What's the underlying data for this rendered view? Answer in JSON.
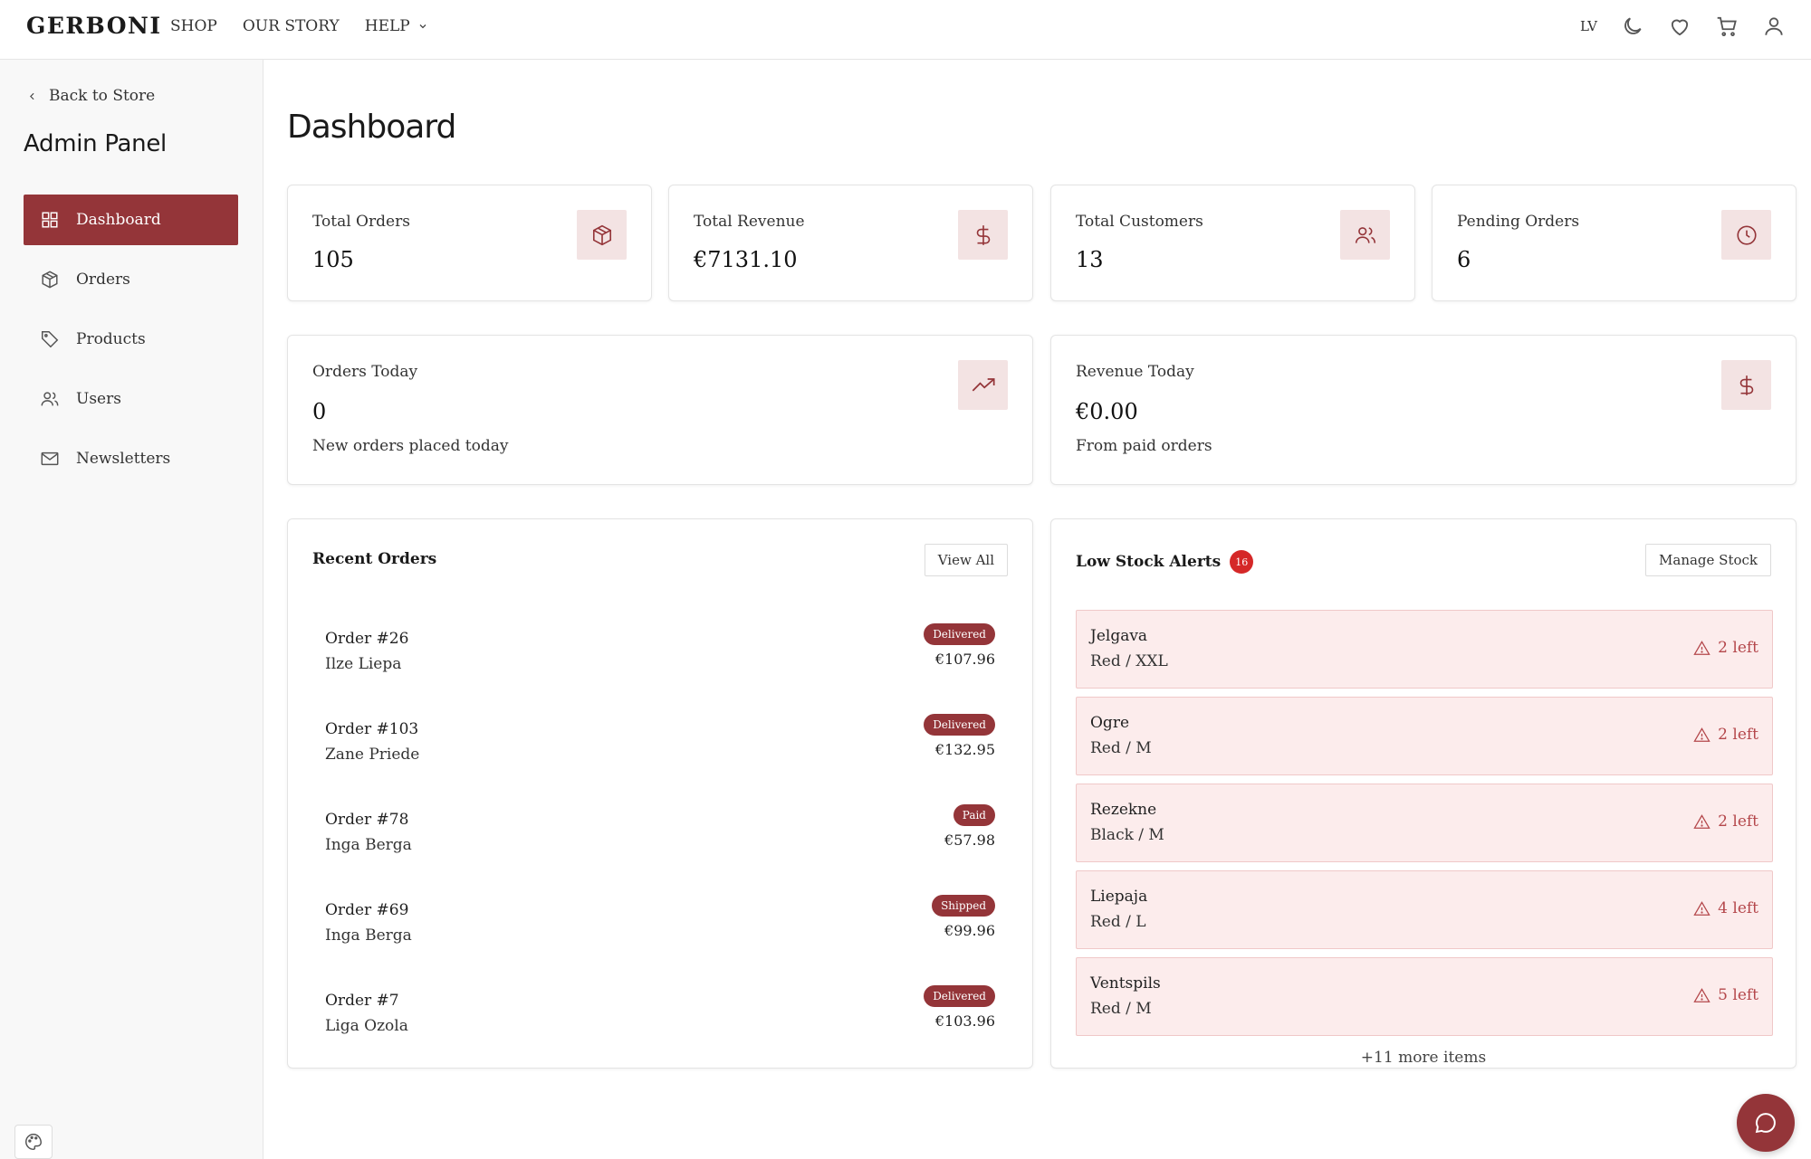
{
  "header": {
    "logo": "GERBONI",
    "nav": [
      {
        "label": "SHOP"
      },
      {
        "label": "OUR STORY"
      },
      {
        "label": "HELP"
      }
    ],
    "lang": "LV",
    "icons": [
      "moon-icon",
      "heart-icon",
      "cart-icon",
      "user-icon"
    ]
  },
  "sidebar": {
    "back_label": "Back to Store",
    "title": "Admin Panel",
    "items": [
      {
        "label": "Dashboard",
        "icon": "grid-icon",
        "active": true
      },
      {
        "label": "Orders",
        "icon": "box-icon"
      },
      {
        "label": "Products",
        "icon": "tag-icon"
      },
      {
        "label": "Users",
        "icon": "users-icon"
      },
      {
        "label": "Newsletters",
        "icon": "mail-icon"
      }
    ]
  },
  "main": {
    "title": "Dashboard",
    "stats": [
      {
        "label": "Total Orders",
        "value": "105",
        "icon": "box-icon"
      },
      {
        "label": "Total Revenue",
        "value": "€7131.10",
        "icon": "dollar-icon"
      },
      {
        "label": "Total Customers",
        "value": "13",
        "icon": "users-icon"
      },
      {
        "label": "Pending Orders",
        "value": "6",
        "icon": "clock-icon"
      }
    ],
    "today": [
      {
        "label": "Orders Today",
        "value": "0",
        "sub": "New orders placed today",
        "icon": "trending-up-icon"
      },
      {
        "label": "Revenue Today",
        "value": "€0.00",
        "sub": "From paid orders",
        "icon": "dollar-icon"
      }
    ],
    "recent_orders": {
      "title": "Recent Orders",
      "button": "View All",
      "rows": [
        {
          "order": "Order #26",
          "customer": "Ilze Liepa",
          "status": "Delivered",
          "amount": "€107.96"
        },
        {
          "order": "Order #103",
          "customer": "Zane Priede",
          "status": "Delivered",
          "amount": "€132.95"
        },
        {
          "order": "Order #78",
          "customer": "Inga Berga",
          "status": "Paid",
          "amount": "€57.98"
        },
        {
          "order": "Order #69",
          "customer": "Inga Berga",
          "status": "Shipped",
          "amount": "€99.96"
        },
        {
          "order": "Order #7",
          "customer": "Liga Ozola",
          "status": "Delivered",
          "amount": "€103.96"
        }
      ]
    },
    "low_stock": {
      "title": "Low Stock Alerts",
      "count": "16",
      "button": "Manage Stock",
      "rows": [
        {
          "name": "Jelgava",
          "variant": "Red / XXL",
          "left": "2 left"
        },
        {
          "name": "Ogre",
          "variant": "Red / M",
          "left": "2 left"
        },
        {
          "name": "Rezekne",
          "variant": "Black / M",
          "left": "2 left"
        },
        {
          "name": "Liepaja",
          "variant": "Red / L",
          "left": "4 left"
        },
        {
          "name": "Ventspils",
          "variant": "Red / M",
          "left": "5 left"
        }
      ],
      "more": "+11 more items"
    }
  },
  "colors": {
    "accent": "#943539",
    "badge": "#d52828",
    "alert_bg": "#fcecec"
  }
}
